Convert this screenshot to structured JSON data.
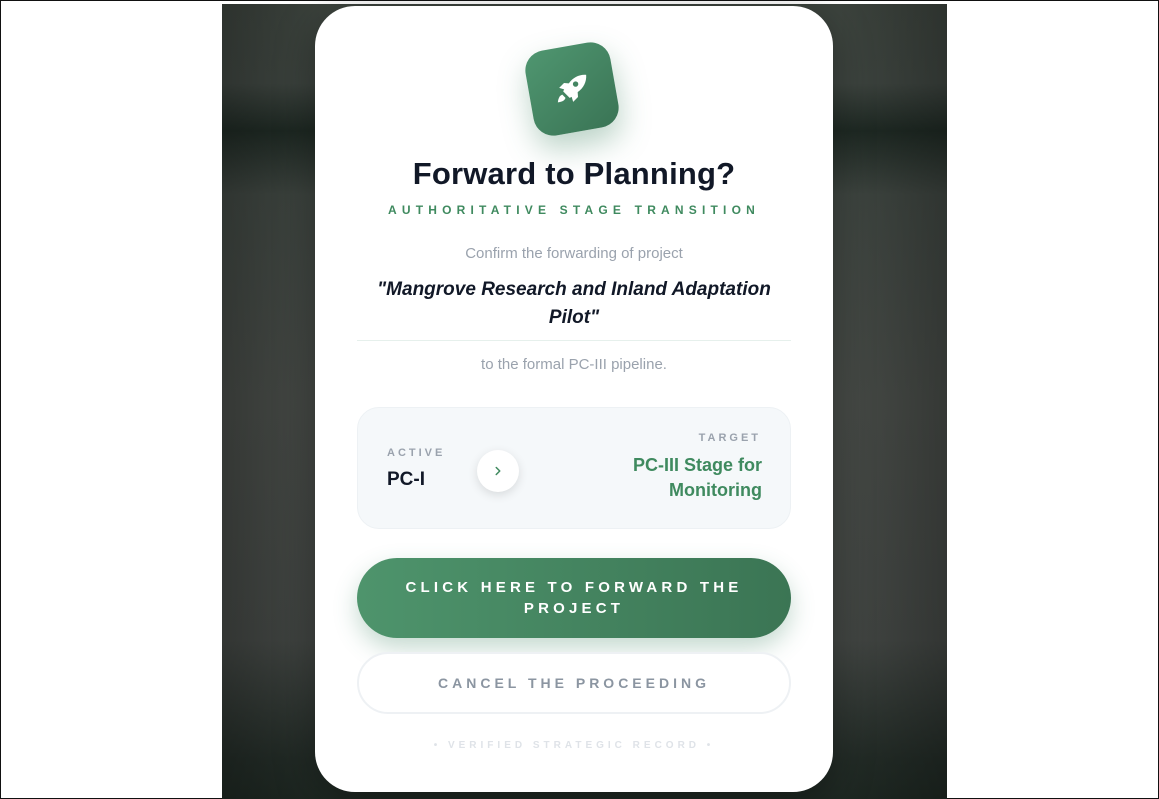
{
  "modal": {
    "title": "Forward to Planning?",
    "subtitle": "AUTHORITATIVE STAGE TRANSITION",
    "confirm_text": "Confirm the forwarding of project",
    "project_name": "\"Mangrove Research and Inland Adaptation Pilot\"",
    "pipeline_text": "to the formal PC-III pipeline.",
    "icon": "rocket-icon"
  },
  "stages": {
    "active_label": "ACTIVE",
    "active_value": "PC-I",
    "target_label": "TARGET",
    "target_value": "PC-III Stage for Monitoring",
    "arrow_icon": "chevron-right-icon"
  },
  "actions": {
    "forward_label": "CLICK HERE TO FORWARD THE PROJECT",
    "cancel_label": "CANCEL THE PROCEEDING"
  },
  "footer": {
    "text": "• VERIFIED STRATEGIC RECORD •"
  },
  "colors": {
    "accent": "#3f8a5f",
    "title": "#111827",
    "muted": "#9aa2ad"
  }
}
